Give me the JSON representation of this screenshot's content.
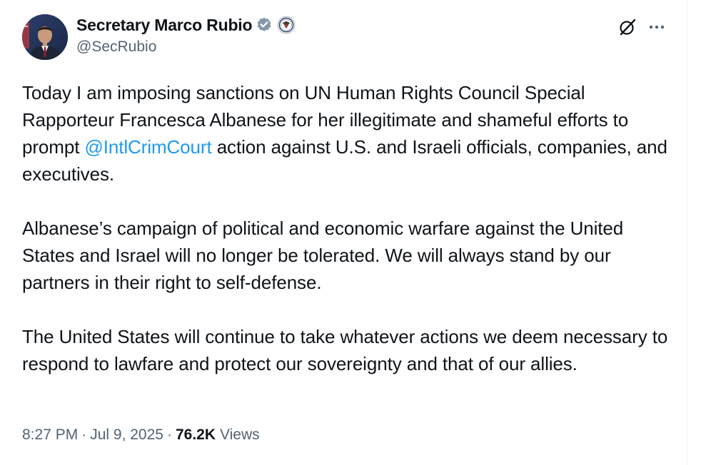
{
  "author": {
    "display_name": "Secretary Marco Rubio",
    "handle": "@SecRubio",
    "verified_badge_color": "#829aab"
  },
  "icons": {
    "verified": "verified-badge-icon",
    "affiliation": "state-department-seal-icon",
    "grok": "grok-icon",
    "more": "more-options-icon"
  },
  "tweet": {
    "p1_a": "Today I am imposing sanctions on UN Human Rights Council Special Rapporteur Francesca Albanese for her illegitimate and shameful efforts to prompt ",
    "p1_mention": "@IntlCrimCourt",
    "p1_b": " action against U.S. and Israeli officials, companies, and executives.",
    "p2": "Albanese’s campaign of political and economic warfare against the United States and Israel will no longer be tolerated. We will always stand by our partners in their right to self-defense.",
    "p3": "The United States will continue to take whatever actions we deem necessary to respond to lawfare and protect our sovereignty and that of our allies."
  },
  "meta": {
    "time": "8:27 PM",
    "separator": "·",
    "date": "Jul 9, 2025",
    "views_count": "76.2K",
    "views_label": "Views"
  },
  "colors": {
    "mention": "#1d9bf0",
    "secondary_text": "#536471",
    "primary_text": "#0f1419"
  }
}
